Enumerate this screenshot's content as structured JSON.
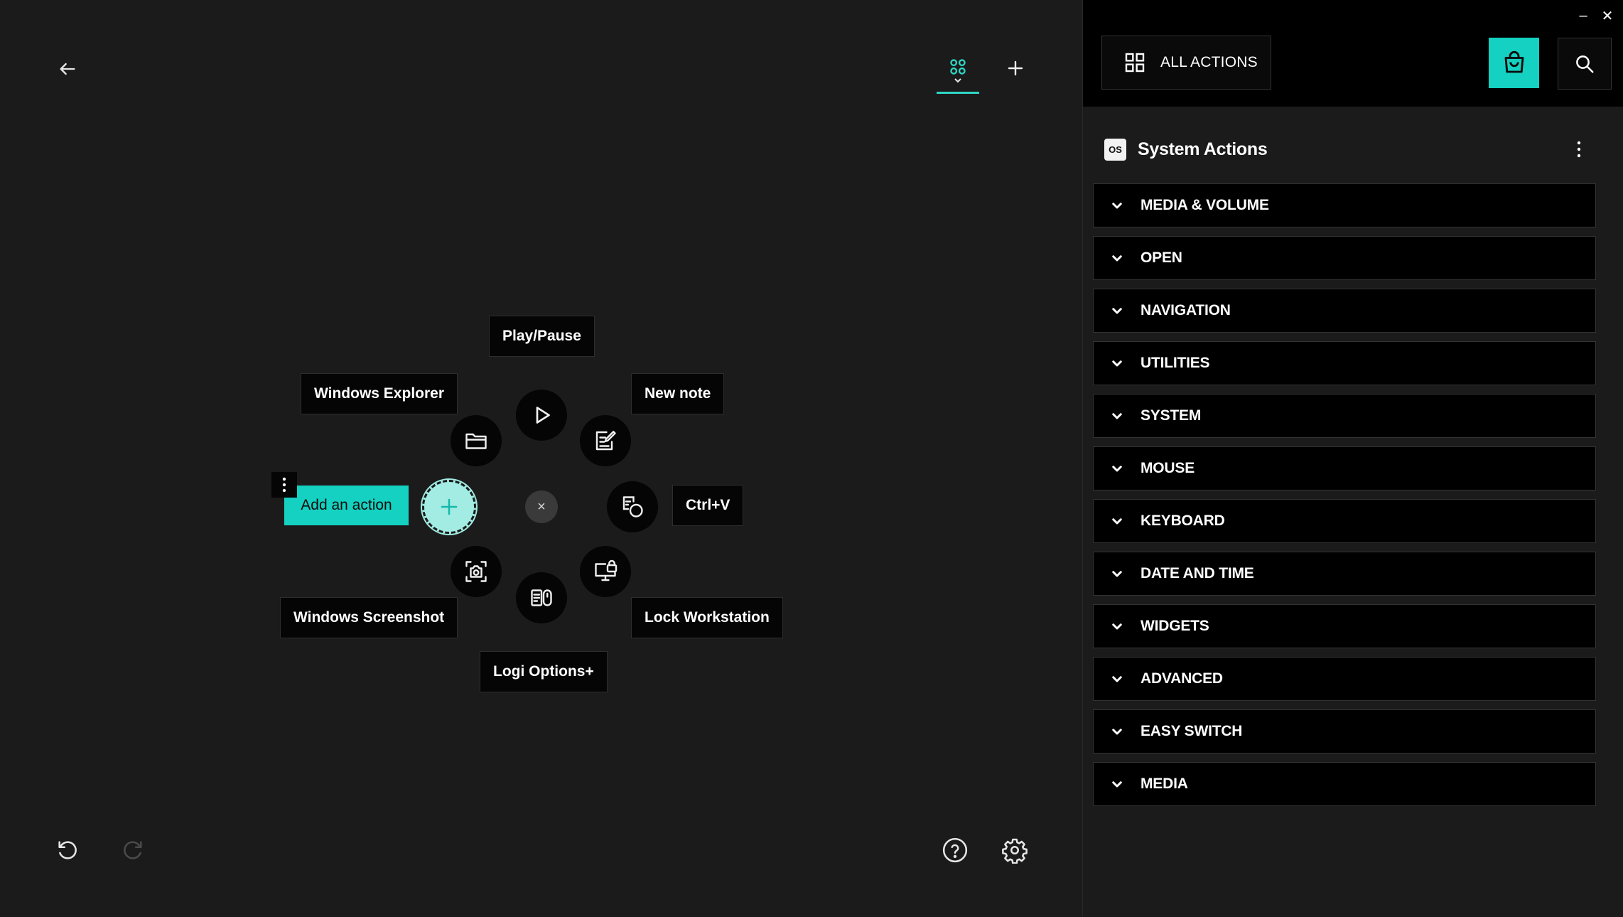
{
  "window": {
    "minimize_glyph": "–",
    "close_glyph": "✕"
  },
  "editor": {
    "back_icon": "arrow-left-icon",
    "layout_tab_icon": "grid-dots-icon",
    "add_layout_icon": "plus-icon",
    "undo_icon": "undo-icon",
    "redo_icon": "redo-icon",
    "help_icon": "help-circle-icon",
    "settings_icon": "gear-icon",
    "radial": {
      "center_close_glyph": "×",
      "slots": [
        {
          "key": "play_pause",
          "label": "Play/Pause",
          "icon": "play-icon"
        },
        {
          "key": "new_note",
          "label": "New note",
          "icon": "note-edit-icon"
        },
        {
          "key": "ctrl_v",
          "label": "Ctrl+V",
          "icon": "paste-icon"
        },
        {
          "key": "lock_workstation",
          "label": "Lock Workstation",
          "icon": "lock-monitor-icon"
        },
        {
          "key": "logi_options",
          "label": "Logi Options+",
          "icon": "logi-options-icon"
        },
        {
          "key": "windows_screenshot",
          "label": "Windows Screenshot",
          "icon": "screenshot-icon"
        },
        {
          "key": "windows_explorer",
          "label": "Windows Explorer",
          "icon": "folder-icon"
        }
      ],
      "add_action_label": "Add an action"
    }
  },
  "panel": {
    "all_actions_label": "ALL ACTIONS",
    "store_icon": "shopping-bag-icon",
    "search_icon": "search-icon",
    "section": {
      "badge": "OS",
      "title": "System Actions"
    },
    "categories": [
      "MEDIA & VOLUME",
      "OPEN",
      "NAVIGATION",
      "UTILITIES",
      "SYSTEM",
      "MOUSE",
      "KEYBOARD",
      "DATE AND TIME",
      "WIDGETS",
      "ADVANCED",
      "EASY SWITCH",
      "MEDIA"
    ]
  },
  "colors": {
    "accent": "#14d1c1",
    "accent_light": "#a2ece3",
    "background": "#1b1b1b",
    "surface": "#000000"
  }
}
